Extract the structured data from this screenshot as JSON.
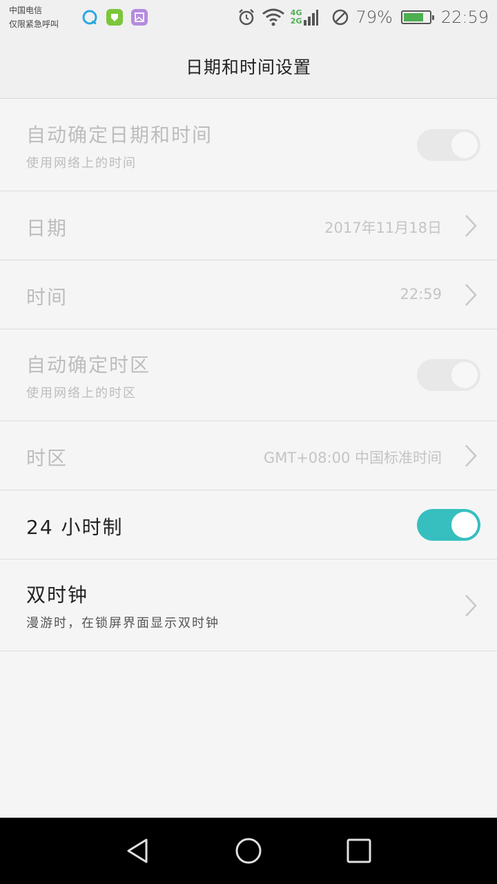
{
  "status_bar": {
    "carrier_line1": "中国电信",
    "carrier_line2": "仅限紧急呼叫",
    "network_4g": "4G",
    "network_2g": "2G",
    "battery_percent": "79%",
    "battery_level": 0.79,
    "clock": "22:59",
    "icons": [
      "browser-icon",
      "shield-app-icon",
      "gallery-app-icon",
      "alarm-icon",
      "wifi-icon",
      "signal-icon",
      "no-disturb-icon",
      "battery-icon"
    ]
  },
  "header": {
    "title": "日期和时间设置"
  },
  "settings": {
    "auto_datetime": {
      "title": "自动确定日期和时间",
      "subtitle": "使用网络上的时间",
      "enabled": false
    },
    "date": {
      "title": "日期",
      "value": "2017年11月18日"
    },
    "time": {
      "title": "时间",
      "value": "22:59"
    },
    "auto_timezone": {
      "title": "自动确定时区",
      "subtitle": "使用网络上的时区",
      "enabled": false
    },
    "timezone": {
      "title": "时区",
      "value": "GMT+08:00 中国标准时间"
    },
    "hour24": {
      "title": "24 小时制",
      "enabled": true
    },
    "dual_clock": {
      "title": "双时钟",
      "subtitle": "漫游时，在锁屏界面显示双时钟"
    }
  },
  "colors": {
    "accent": "#36bfbe",
    "battery_green": "#4caf50"
  }
}
